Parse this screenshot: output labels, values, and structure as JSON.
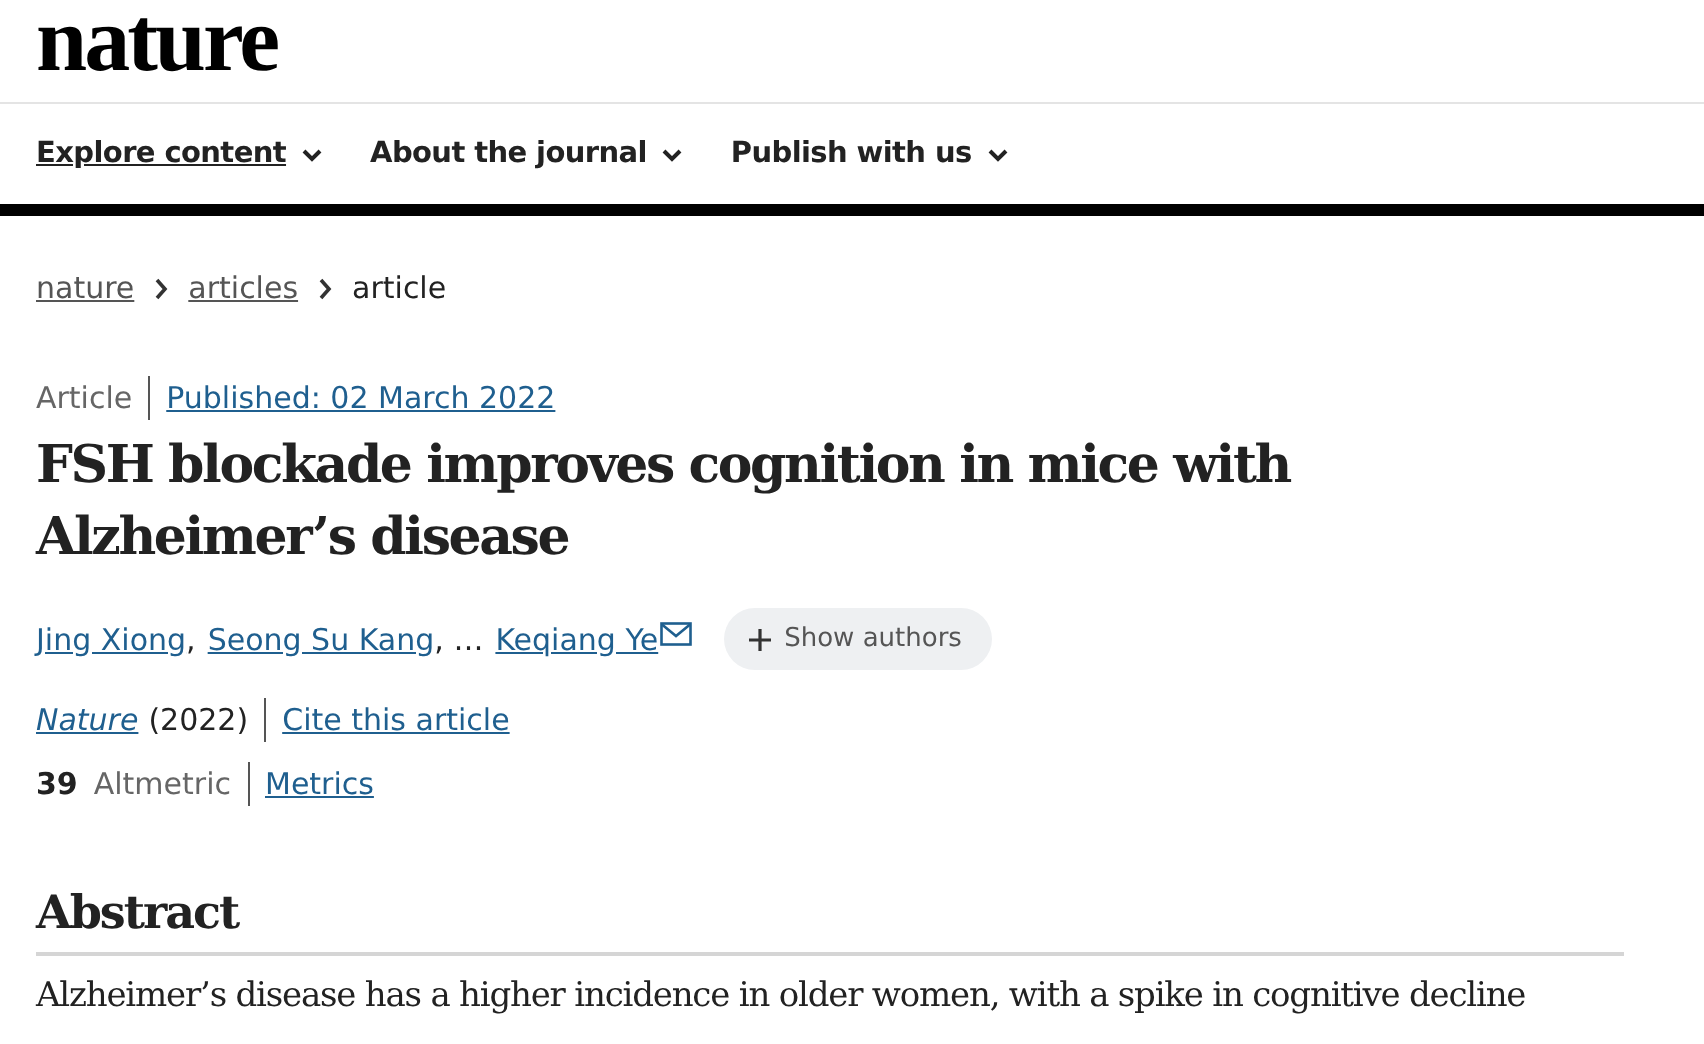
{
  "header": {
    "logo": "nature"
  },
  "nav": [
    {
      "label": "Explore content",
      "selected": true
    },
    {
      "label": "About the journal",
      "selected": false
    },
    {
      "label": "Publish with us",
      "selected": false
    }
  ],
  "breadcrumb": [
    {
      "label": "nature",
      "link": true
    },
    {
      "label": "articles",
      "link": true
    },
    {
      "label": "article",
      "link": false
    }
  ],
  "article": {
    "type": "Article",
    "published": "Published: 02 March 2022",
    "title": "FSH blockade improves cognition in mice with Alzheimer’s disease",
    "authors": [
      {
        "name": "Jing Xiong",
        "sep": ",",
        "email": false
      },
      {
        "name": "Seong Su Kang",
        "sep": ", …",
        "email": false
      },
      {
        "name": "Keqiang Ye",
        "email": true
      }
    ],
    "show_authors": "Show authors",
    "journal": "Nature",
    "year": "(2022)",
    "cite": "Cite this article",
    "altmetric_score": "39",
    "altmetric_label": "Altmetric",
    "metrics": "Metrics"
  },
  "abstract": {
    "heading": "Abstract",
    "text": "Alzheimer’s disease has a higher incidence in older women, with a spike in cognitive decline"
  }
}
